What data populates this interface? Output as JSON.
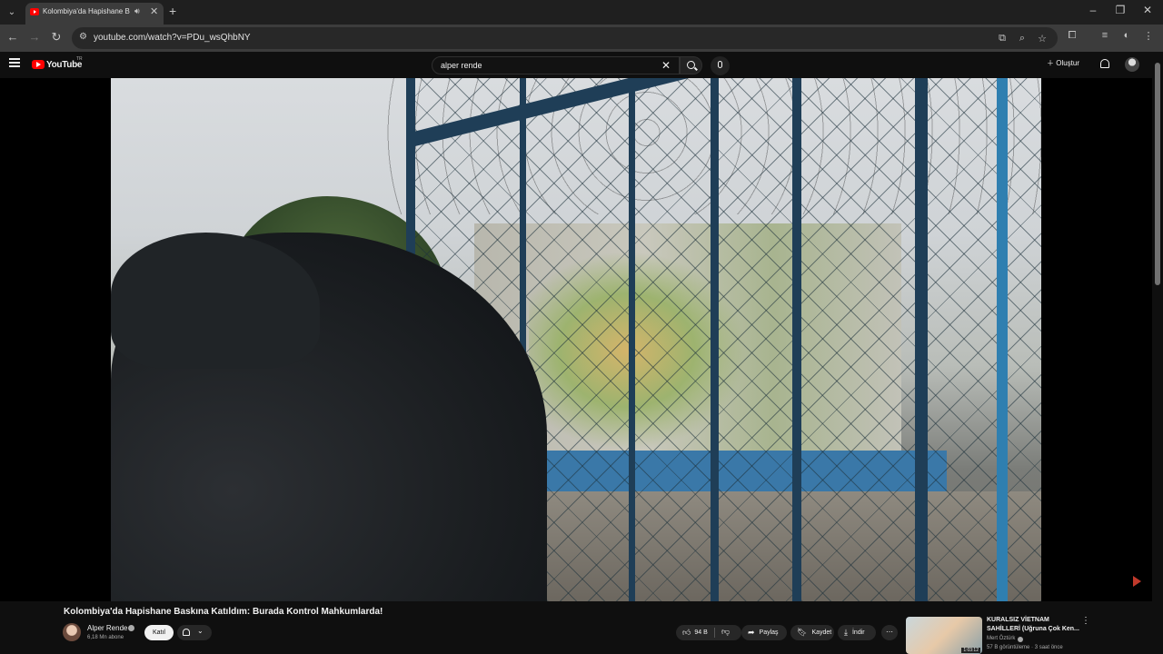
{
  "browser": {
    "tab_title": "Kolombiya'da Hapishane Ba",
    "url": "youtube.com/watch?v=PDu_wsQhbNY"
  },
  "youtube": {
    "logo_text": "YouTube",
    "country_code": "TR",
    "search_query": "alper rende",
    "create_label": "Oluştur"
  },
  "video": {
    "title": "Kolombiya'da Hapishane Baskına Katıldım: Burada Kontrol Mahkumlarda!",
    "channel": "Alper Rende",
    "subscribers": "6,18 Mn abone",
    "join_label": "Katıl",
    "likes": "94 B",
    "share_label": "Paylaş",
    "save_label": "Kaydet",
    "download_label": "İndir"
  },
  "recommendation": {
    "title": "KURALSIZ VİETNAM SAHİLLERİ (Uğruna Çok Ken...",
    "channel": "Mert Öztürk",
    "meta": "57 B görüntüleme · 3 saat önce",
    "duration": "1:03:12"
  },
  "icons": {
    "tab_audio": "speaker-icon",
    "brand_color": "#ff0000"
  }
}
